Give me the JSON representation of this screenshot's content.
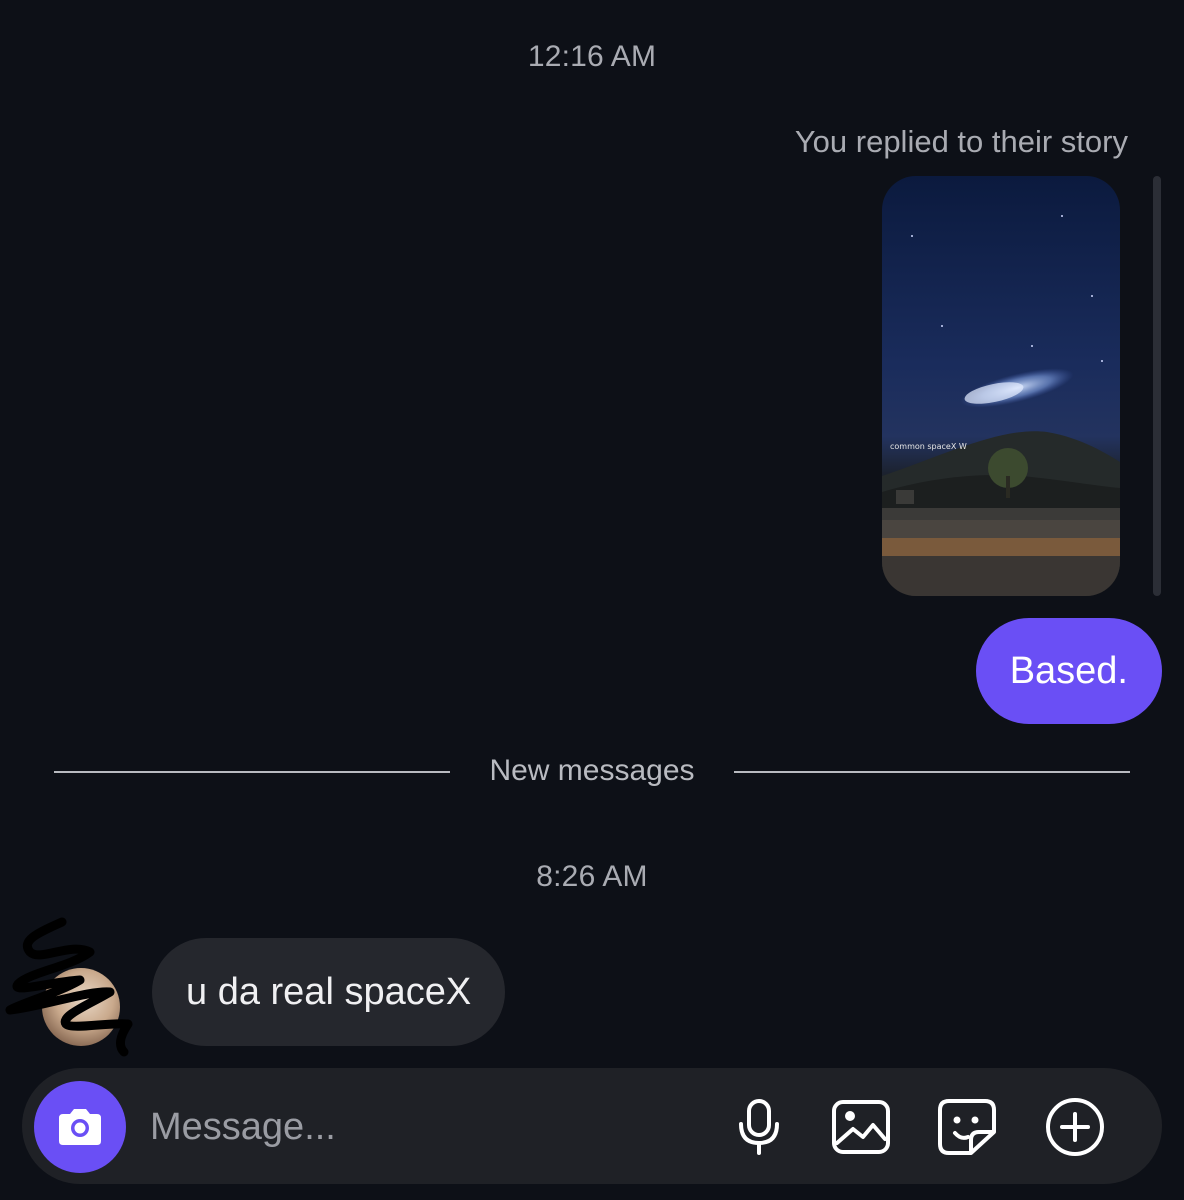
{
  "conversation": {
    "timestamp_1": "12:16 AM",
    "story_reply_label": "You replied to their story",
    "story_caption": "common spaceX W",
    "outgoing_message": "Based.",
    "divider_label": "New messages",
    "timestamp_2": "8:26 AM",
    "incoming_message": "u da real spaceX"
  },
  "composer": {
    "placeholder": "Message...",
    "icons": [
      "camera-icon",
      "microphone-icon",
      "gallery-icon",
      "sticker-icon",
      "plus-icon"
    ]
  },
  "colors": {
    "background": "#0d1017",
    "accent": "#6a4ff5",
    "incoming_bubble": "#25272d",
    "composer": "#1f2126",
    "muted_text": "#a9abb2"
  }
}
